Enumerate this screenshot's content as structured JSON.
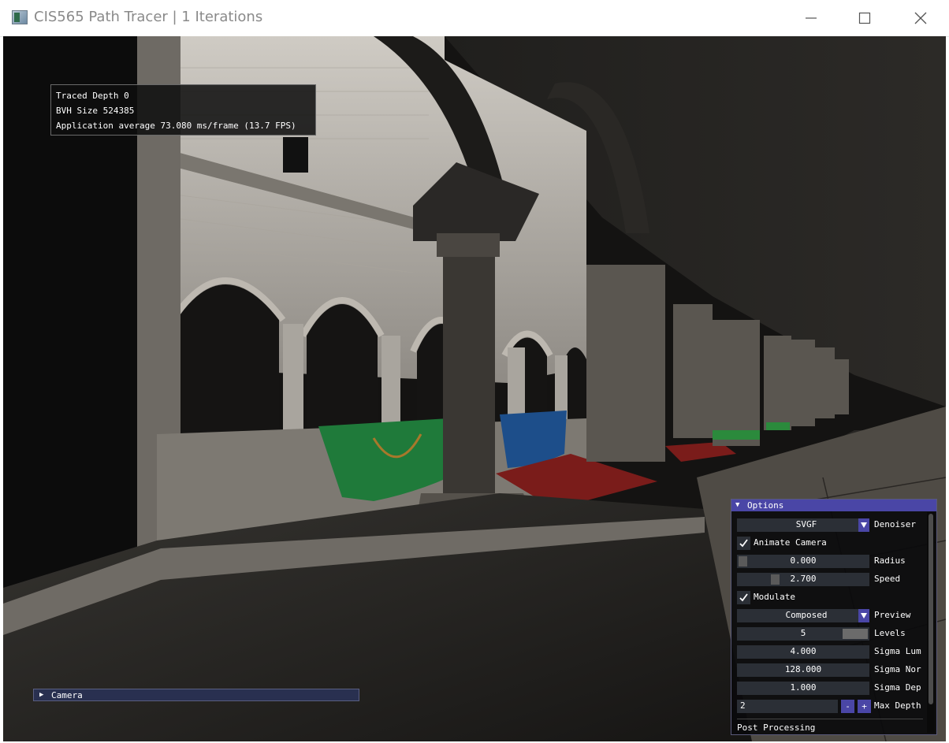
{
  "window": {
    "title": "CIS565 Path Tracer | 1 Iterations",
    "icon": "app-window-icon"
  },
  "overlay": {
    "traced_depth": "Traced Depth 0",
    "bvh_size": "BVH Size 524385",
    "fps": "Application average 73.080 ms/frame (13.7 FPS)"
  },
  "camera_panel": {
    "label": "Camera",
    "expanded": false
  },
  "options": {
    "header": "Options",
    "denoiser": {
      "value": "SVGF",
      "label": "Denoiser"
    },
    "animate_camera": {
      "label": "Animate Camera",
      "checked": true
    },
    "radius": {
      "value": "0.000",
      "label": "Radius",
      "fraction": 0.0
    },
    "speed": {
      "value": "2.700",
      "label": "Speed",
      "fraction": 0.27
    },
    "modulate": {
      "label": "Modulate",
      "checked": true
    },
    "preview": {
      "value": "Composed",
      "label": "Preview"
    },
    "levels": {
      "value": "5",
      "label": "Levels",
      "fraction": 1.0
    },
    "sigma_lum": {
      "value": "4.000",
      "label": "Sigma Lum"
    },
    "sigma_nor": {
      "value": "128.000",
      "label": "Sigma Nor"
    },
    "sigma_dep": {
      "value": "1.000",
      "label": "Sigma Dep"
    },
    "max_depth": {
      "value": "2",
      "label": "Max Depth",
      "minus": "-",
      "plus": "+"
    },
    "post_processing": "Post Processing"
  },
  "colors": {
    "panel_header": "#4a46a6",
    "field_bg": "#2b2f36",
    "camera_header": "#293050"
  }
}
